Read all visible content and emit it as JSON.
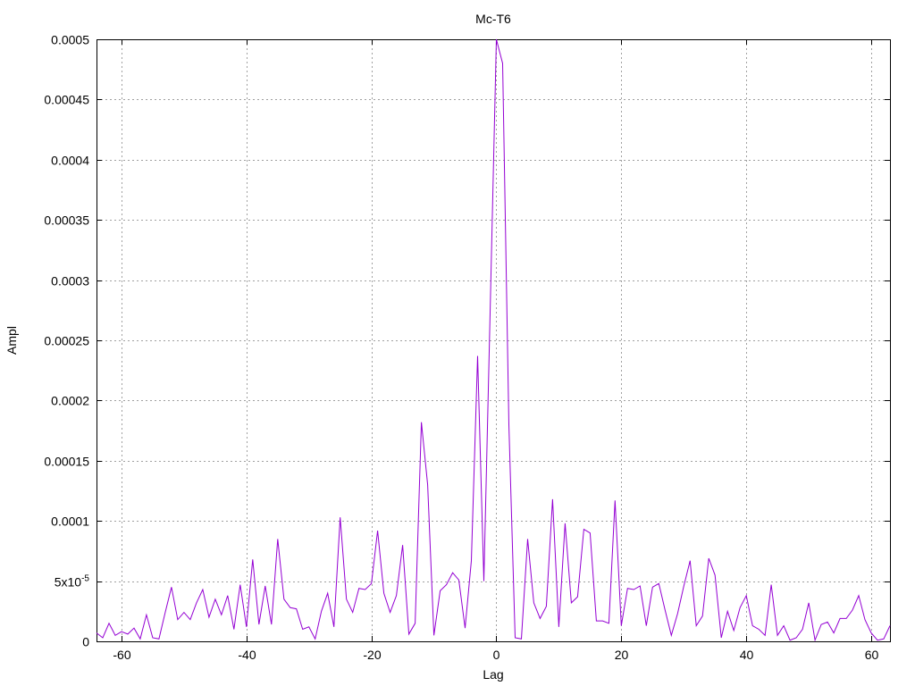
{
  "chart_data": {
    "type": "line",
    "title": "Mc-T6",
    "xlabel": "Lag",
    "ylabel": "Ampl",
    "xlim": [
      -64,
      63
    ],
    "ylim": [
      0,
      0.0005
    ],
    "grid": true,
    "x_ticks": [
      -60,
      -40,
      -20,
      0,
      20,
      40,
      60
    ],
    "x_tick_labels": [
      "-60",
      "-40",
      "-20",
      "0",
      "20",
      "40",
      "60"
    ],
    "y_ticks": [
      0,
      5e-05,
      0.0001,
      0.00015,
      0.0002,
      0.00025,
      0.0003,
      0.00035,
      0.0004,
      0.00045,
      0.0005
    ],
    "y_tick_labels": [
      "0",
      "5x10",
      "0.0001",
      "0.00015",
      "0.0002",
      "0.00025",
      "0.0003",
      "0.00035",
      "0.0004",
      "0.00045",
      "0.0005"
    ],
    "y_tick_superscript": {
      "index": 1,
      "text": "-5"
    },
    "series": [
      {
        "color": "#9400d3",
        "x": [
          -64,
          -63,
          -62,
          -61,
          -60,
          -59,
          -58,
          -57,
          -56,
          -55,
          -54,
          -53,
          -52,
          -51,
          -50,
          -49,
          -48,
          -47,
          -46,
          -45,
          -44,
          -43,
          -42,
          -41,
          -40,
          -39,
          -38,
          -37,
          -36,
          -35,
          -34,
          -33,
          -32,
          -31,
          -30,
          -29,
          -28,
          -27,
          -26,
          -25,
          -24,
          -23,
          -22,
          -21,
          -20,
          -19,
          -18,
          -17,
          -16,
          -15,
          -14,
          -13,
          -12,
          -11,
          -10,
          -9,
          -8,
          -7,
          -6,
          -5,
          -4,
          -3,
          -2,
          -1,
          0,
          1,
          2,
          3,
          4,
          5,
          6,
          7,
          8,
          9,
          10,
          11,
          12,
          13,
          14,
          15,
          16,
          17,
          18,
          19,
          20,
          21,
          22,
          23,
          24,
          25,
          26,
          27,
          28,
          29,
          30,
          31,
          32,
          33,
          34,
          35,
          36,
          37,
          38,
          39,
          40,
          41,
          42,
          43,
          44,
          45,
          46,
          47,
          48,
          49,
          50,
          51,
          52,
          53,
          54,
          55,
          56,
          57,
          58,
          59,
          60,
          61,
          62,
          63
        ],
        "values": [
          7e-06,
          3e-06,
          1.5e-05,
          5e-06,
          8e-06,
          6e-06,
          1.1e-05,
          2e-06,
          2.2e-05,
          3e-06,
          2e-06,
          2.4e-05,
          4.5e-05,
          1.8e-05,
          2.4e-05,
          1.8e-05,
          3.2e-05,
          4.3e-05,
          2e-05,
          3.5e-05,
          2.2e-05,
          3.8e-05,
          1e-05,
          4.7e-05,
          1.2e-05,
          6.8e-05,
          1.4e-05,
          4.6e-05,
          1.4e-05,
          8.5e-05,
          3.5e-05,
          2.8e-05,
          2.7e-05,
          1e-05,
          1.2e-05,
          2e-06,
          2.5e-05,
          4e-05,
          1.2e-05,
          0.000103,
          3.5e-05,
          2.4e-05,
          4.4e-05,
          4.3e-05,
          4.8e-05,
          9.2e-05,
          4e-05,
          2.4e-05,
          3.8e-05,
          8e-05,
          6e-06,
          1.5e-05,
          0.000182,
          0.00013,
          5e-06,
          4.2e-05,
          4.7e-05,
          5.7e-05,
          5.1e-05,
          1.1e-05,
          6.7e-05,
          0.000237,
          5e-05,
          0.000273,
          0.0005,
          0.00048,
          0.00018,
          3e-06,
          2e-06,
          8.5e-05,
          3.2e-05,
          1.9e-05,
          2.9e-05,
          0.000118,
          1.2e-05,
          9.8e-05,
          3.2e-05,
          3.7e-05,
          9.3e-05,
          9e-05,
          1.7e-05,
          1.7e-05,
          1.5e-05,
          0.000117,
          1.3e-05,
          4.4e-05,
          4.3e-05,
          4.6e-05,
          1.3e-05,
          4.5e-05,
          4.8e-05,
          2.6e-05,
          5e-06,
          2.3e-05,
          4.6e-05,
          6.7e-05,
          1.3e-05,
          2.1e-05,
          6.9e-05,
          5.5e-05,
          3e-06,
          2.5e-05,
          9e-06,
          2.8e-05,
          3.8e-05,
          1.3e-05,
          1e-05,
          5e-06,
          4.7e-05,
          5e-06,
          1.3e-05,
          1e-06,
          3e-06,
          1e-05,
          3.2e-05,
          1e-06,
          1.4e-05,
          1.6e-05,
          7e-06,
          1.9e-05,
          1.9e-05,
          2.6e-05,
          3.8e-05,
          1.8e-05,
          7e-06,
          1e-06,
          2e-06,
          1.3e-05
        ]
      }
    ]
  }
}
